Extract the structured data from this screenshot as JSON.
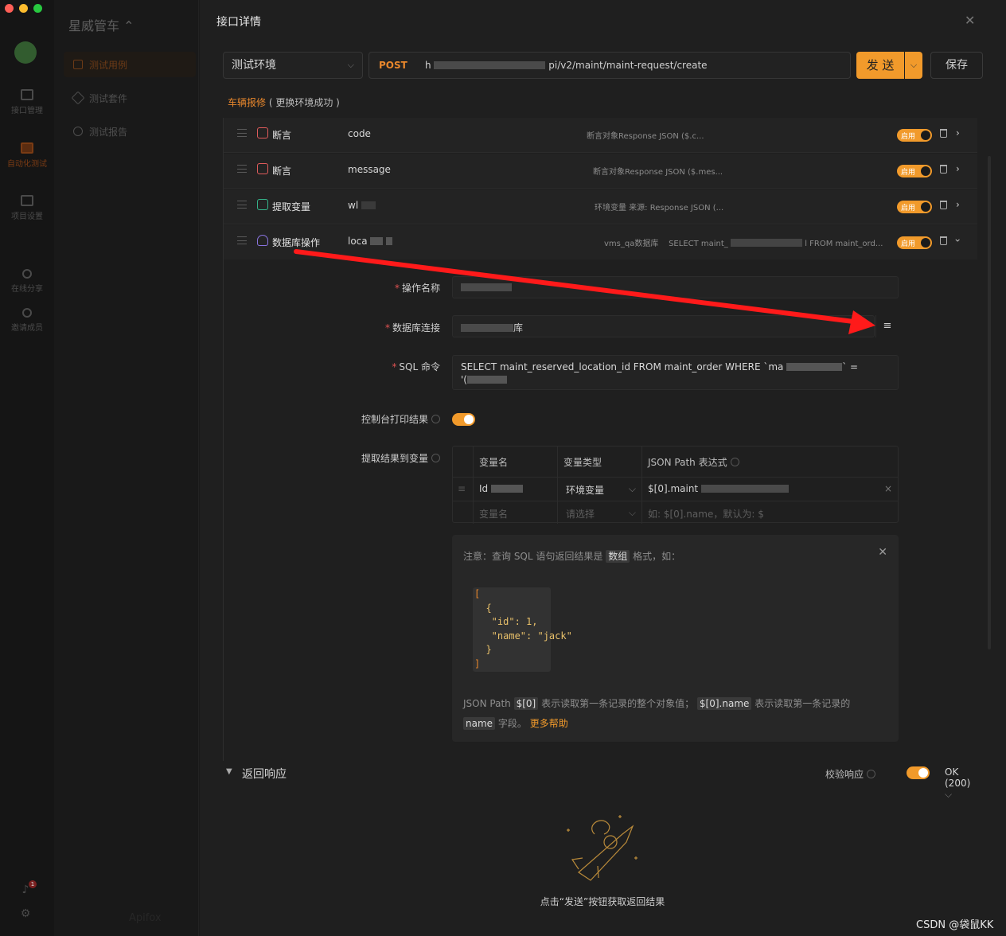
{
  "rail": {
    "items": [
      {
        "label": "接口管理"
      },
      {
        "label": "自动化测试"
      },
      {
        "label": "项目设置"
      },
      {
        "label": "在线分享"
      },
      {
        "label": "邀请成员"
      }
    ],
    "bell_count": "1"
  },
  "sidebar": {
    "project_name": "星威管车 ⌃",
    "items": [
      {
        "label": "测试用例"
      },
      {
        "label": "测试套件"
      },
      {
        "label": "测试报告"
      }
    ],
    "footer": "Apifox"
  },
  "dialog": {
    "title": "接口详情",
    "environment": "测试环境",
    "method": "POST",
    "url_prefix": "h",
    "url_suffix": "pi/v2/maint/maint-request/create",
    "send_label": "发 送",
    "save_label": "保存",
    "env_note_name": "车辆报修",
    "env_note_status": "( 更换环境成功 )"
  },
  "steps": [
    {
      "type": "断言",
      "name": "code",
      "desc": "断言对象Response JSON ($.c...",
      "enabled": "启用"
    },
    {
      "type": "断言",
      "name": "message",
      "desc": "断言对象Response JSON ($.mes...",
      "enabled": "启用"
    },
    {
      "type": "提取变量",
      "name": "wl",
      "desc": "环境变量    来源: Response JSON (...",
      "enabled": "启用"
    },
    {
      "type": "数据库操作",
      "name": "loca",
      "desc_db": "vms_qa数据库",
      "desc_sql": "SELECT maint_",
      "desc_tail": "l FROM maint_ord...",
      "enabled": "启用"
    }
  ],
  "db_step": {
    "op_name_label": "操作名称",
    "db_conn_label": "数据库连接",
    "db_conn_suffix": "库",
    "sql_label": "SQL 命令",
    "sql_line1": "SELECT maint_reserved_location_id FROM maint_order WHERE `ma",
    "sql_line1_tail": "` =",
    "sql_line2": "'(",
    "console_label": "控制台打印结果",
    "extract_label": "提取结果到变量",
    "table": {
      "headers": [
        "变量名",
        "变量类型",
        "JSON Path 表达式"
      ],
      "row": {
        "var": "Id",
        "type": "环境变量",
        "path": "$[0].maint"
      },
      "placeholders": {
        "var": "变量名",
        "type": "请选择",
        "path": "如: $[0].name，默认为: $"
      }
    },
    "note": {
      "intro_before": "注意：查询 SQL 语句返回结果是",
      "intro_tag": "数组",
      "intro_after": "格式，如：",
      "code_lines": [
        "[",
        "  {",
        "   \"id\": 1,",
        "   \"name\": \"jack\"",
        "  }",
        "]"
      ],
      "foot_1": "JSON Path",
      "foot_tag1": "$[0]",
      "foot_2": "表示读取第一条记录的整个对象值；",
      "foot_tag2": "$[0].name",
      "foot_3": "表示读取第一条记录的",
      "foot_tag3": "name",
      "foot_4": "字段。",
      "foot_link": "更多帮助"
    }
  },
  "response": {
    "title": "返回响应",
    "verify_label": "校验响应",
    "status": "OK (200)",
    "empty_text": "点击“发送”按钮获取返回结果"
  },
  "watermark": "CSDN @袋鼠KK",
  "colors": {
    "accent": "#f19a2b",
    "post": "#e8872c",
    "assert_icon": "#e05b5b",
    "extract_icon": "#35b38a",
    "db_icon": "#8a74e0",
    "annotation_arrow": "#ff1a1a"
  }
}
